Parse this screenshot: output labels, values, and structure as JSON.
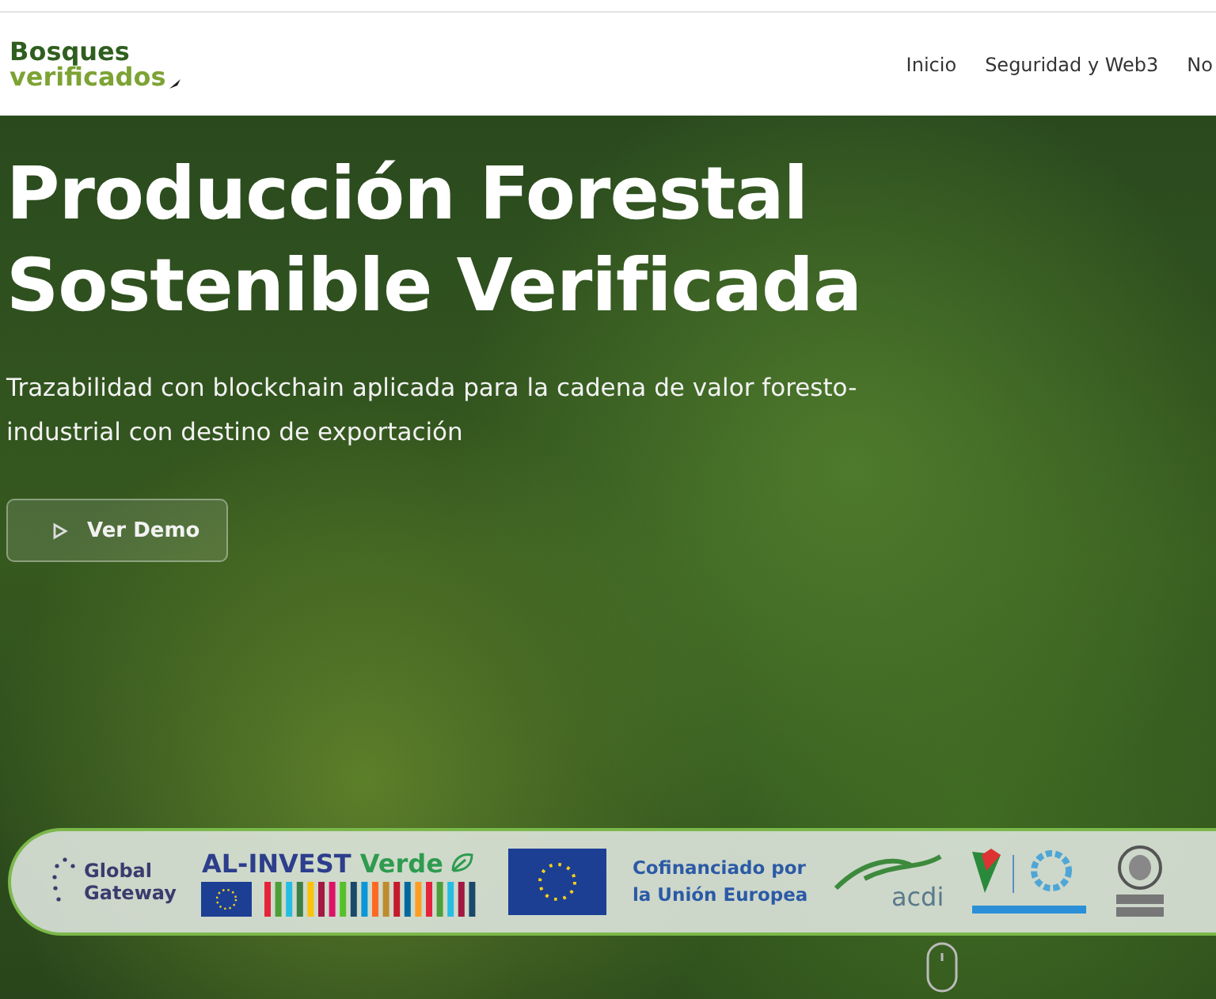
{
  "header": {
    "logo": {
      "line_1": "Bosques",
      "line_2": "verificados"
    },
    "nav": [
      {
        "label": "Inicio"
      },
      {
        "label": "Seguridad y Web3"
      },
      {
        "label": "No"
      }
    ]
  },
  "hero": {
    "title_lines": [
      "Producción Forestal",
      "Sostenible Verificada"
    ],
    "subtitle": "Trazabilidad con blockchain aplicada para la cadena de valor foresto-industrial con destino de exportación",
    "button": "Ver Demo"
  },
  "partners": {
    "global_gateway": [
      "Global",
      "Gateway"
    ],
    "al_invest": {
      "name": "AL-INVEST",
      "accent": "Verde"
    },
    "eu_text": [
      "Cofinanciado por",
      "la Unión Europea"
    ],
    "acdi": "acdi"
  }
}
